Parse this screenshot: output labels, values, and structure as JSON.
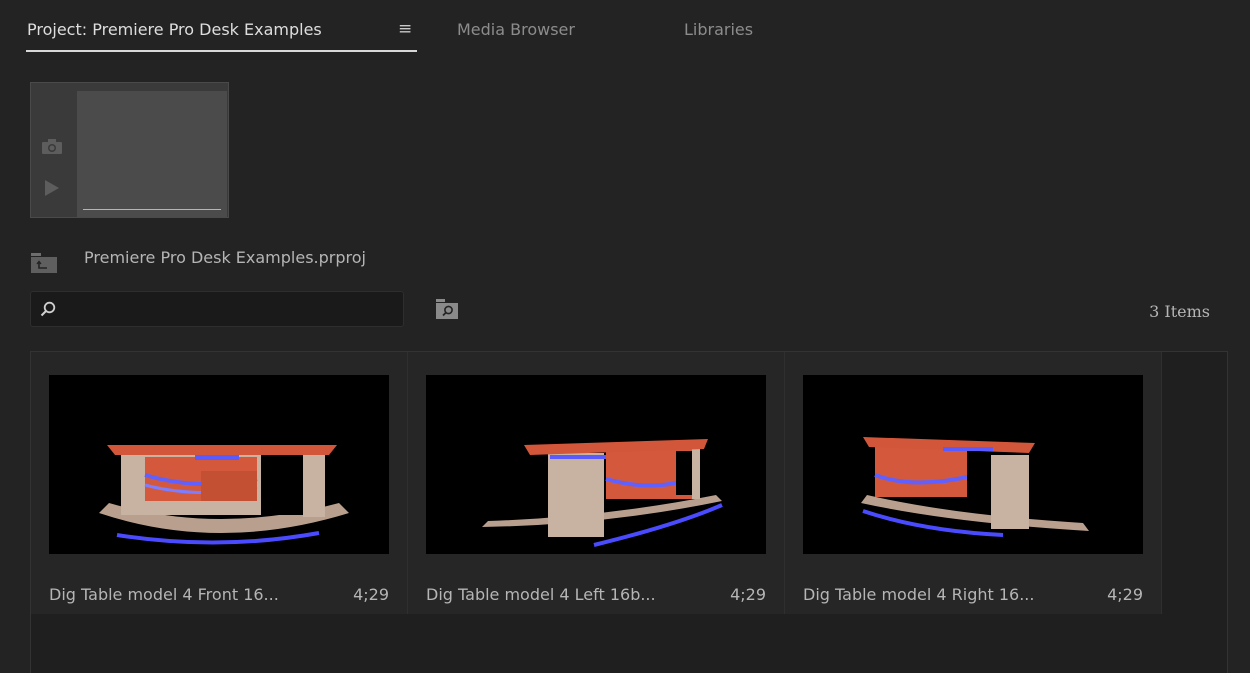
{
  "tabs": [
    {
      "label": "Project: Premiere Pro Desk Examples",
      "active": true
    },
    {
      "label": "Media Browser",
      "active": false
    },
    {
      "label": "Libraries",
      "active": false
    }
  ],
  "tab_menu_glyph": "≡",
  "project": {
    "filename": "Premiere Pro Desk Examples.prproj"
  },
  "search": {
    "value": "",
    "placeholder": ""
  },
  "items_count": "3 Items",
  "clips": [
    {
      "name": "Dig Table model 4 Front 16...",
      "duration": "4;29",
      "view": "front"
    },
    {
      "name": "Dig Table model 4 Left 16b...",
      "duration": "4;29",
      "view": "left"
    },
    {
      "name": "Dig Table model 4 Right 16...",
      "duration": "4;29",
      "view": "right"
    }
  ],
  "colors": {
    "background": "#232323",
    "active_tab_text": "#dedede",
    "inactive_tab_text": "#8c8c8c",
    "desk_top": "#d2563a",
    "desk_light": "#5a5aff",
    "desk_base": "#b8a08e"
  },
  "icons": {
    "tab_menu": "hamburger-icon",
    "preview_camera": "camera-icon",
    "preview_play": "play-icon",
    "project_folder": "folder-up-icon",
    "search": "search-icon",
    "find": "find-folder-icon"
  }
}
